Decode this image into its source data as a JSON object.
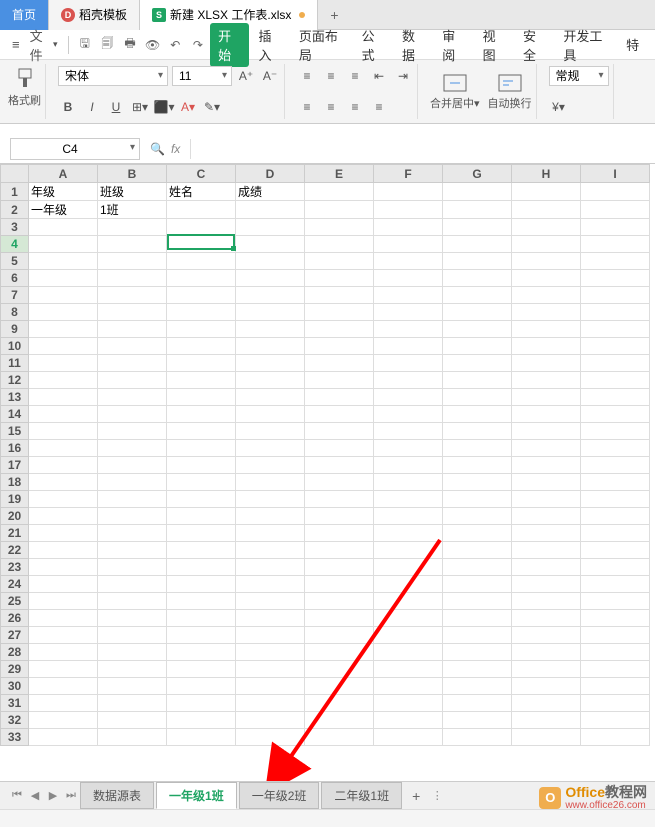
{
  "top_tabs": {
    "home": "首页",
    "template": "稻壳模板",
    "workbook": "新建 XLSX 工作表.xlsx"
  },
  "menubar": {
    "file": "文件",
    "ribbon_tabs": [
      "开始",
      "插入",
      "页面布局",
      "公式",
      "数据",
      "审阅",
      "视图",
      "安全",
      "开发工具",
      "特"
    ]
  },
  "ribbon": {
    "format_brush": "格式刷",
    "font_name": "宋体",
    "font_size": "11",
    "merge_center": "合并居中",
    "auto_wrap": "自动换行",
    "number_format": "常规"
  },
  "formula_bar": {
    "name_box": "C4",
    "fx_label": "fx"
  },
  "columns": [
    "A",
    "B",
    "C",
    "D",
    "E",
    "F",
    "G",
    "H",
    "I"
  ],
  "row_count": 33,
  "cells": {
    "A1": "年级",
    "B1": "班级",
    "C1": "姓名",
    "D1": "成绩",
    "A2": "一年级",
    "B2": "1班"
  },
  "selected": {
    "ref": "C4",
    "col": 2,
    "row": 3
  },
  "sheet_tabs": {
    "items": [
      "数据源表",
      "一年级1班",
      "一年级2班",
      "二年级1班"
    ],
    "active_index": 1
  },
  "watermark": {
    "brand1": "Office",
    "brand2": "教程网",
    "url": "www.office26.com"
  }
}
